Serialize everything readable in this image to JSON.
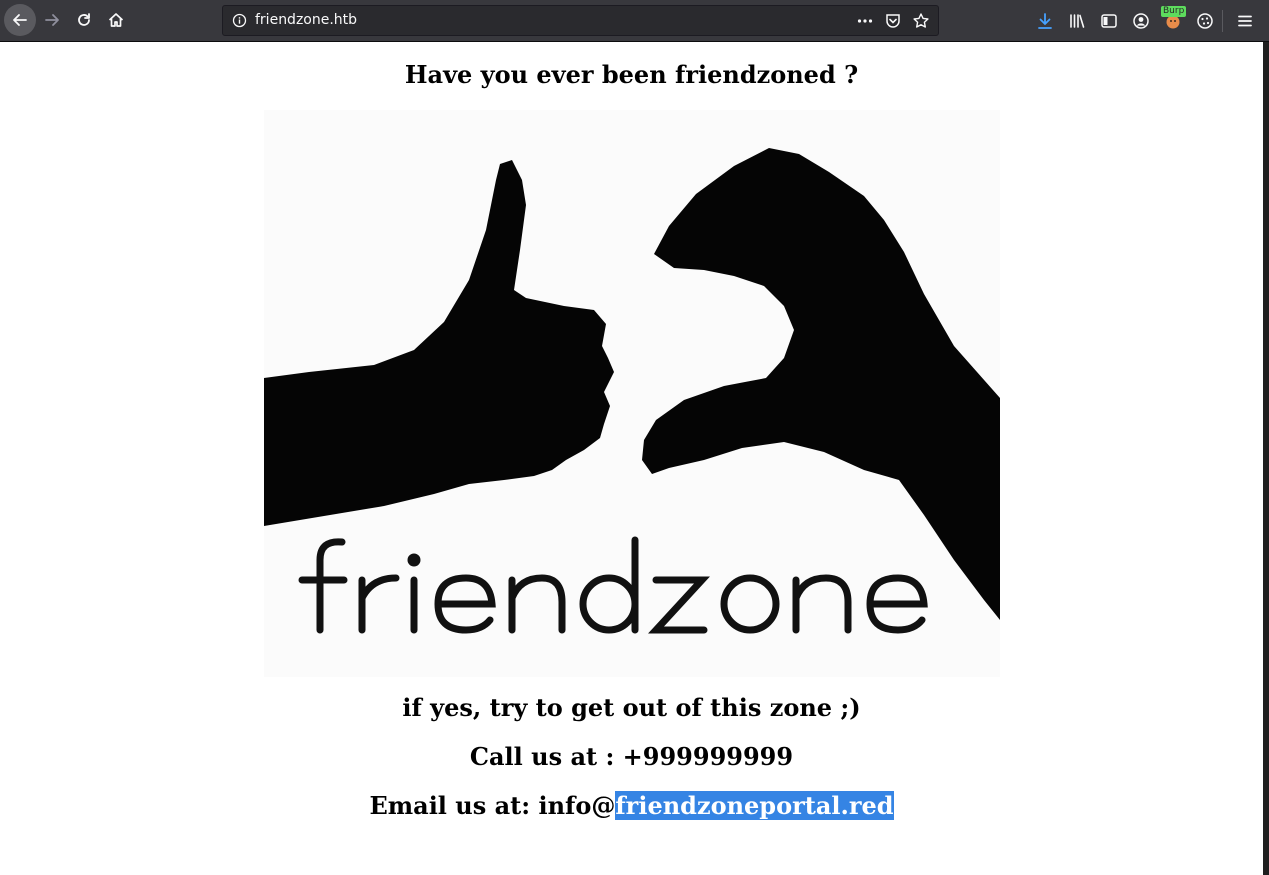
{
  "browser": {
    "url": "friendzone.htb",
    "burp_badge": "Burp"
  },
  "page": {
    "title_line": "Have you ever been friendzoned ?",
    "logo_word": "friendzone",
    "tagline": "if yes, try to get out of this zone ;)",
    "call_line": "Call us at : +999999999",
    "email_prefix": "Email us at: info@",
    "email_domain_selected": "friendzoneportal.red"
  },
  "colors": {
    "chrome": "#38383d",
    "selection": "#3584e4",
    "download_accent": "#45a1ff"
  }
}
